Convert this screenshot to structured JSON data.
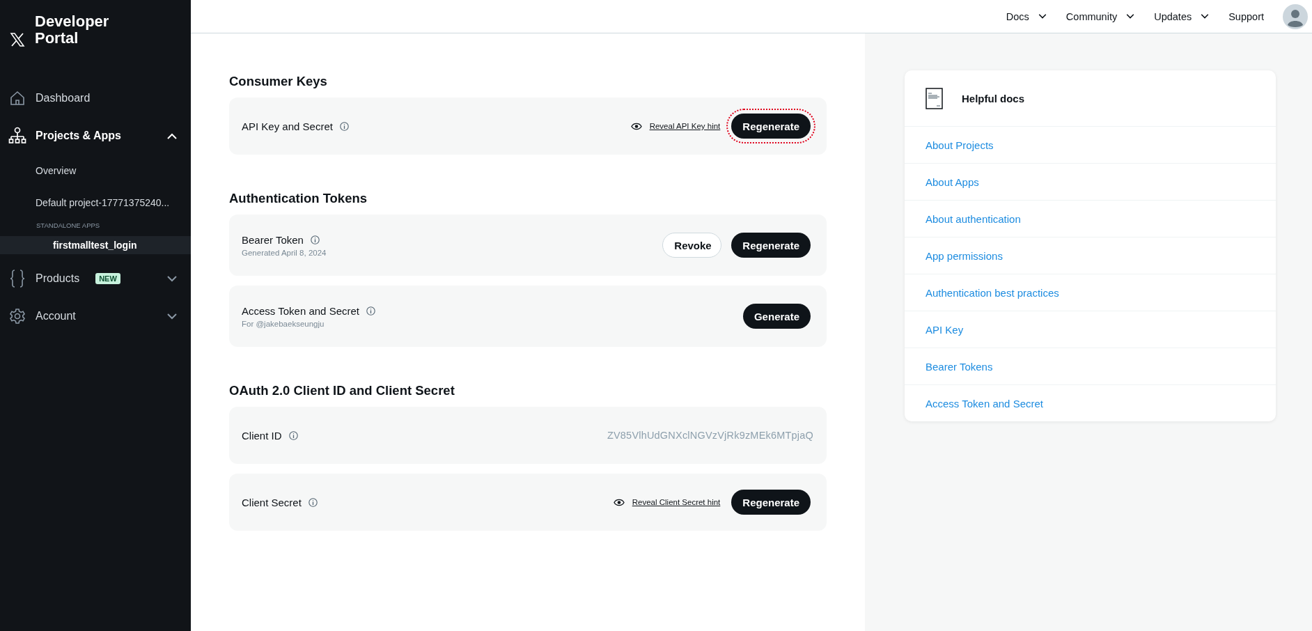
{
  "sidebar": {
    "brand": "Developer Portal",
    "items": [
      {
        "kind": "nav",
        "label": "Dashboard",
        "selected": false
      },
      {
        "kind": "group",
        "label": "Projects & Apps",
        "expanded": true,
        "selected": false,
        "children": [
          {
            "kind": "link",
            "label": "Overview",
            "selected": false
          },
          {
            "kind": "link",
            "label": "Default project-17771375240...",
            "selected": false
          },
          {
            "kind": "section",
            "label": "STANDALONE APPS"
          },
          {
            "kind": "app",
            "label": "firstmalltest_login",
            "selected": true
          }
        ]
      },
      {
        "kind": "group",
        "label": "Products",
        "badge": "NEW",
        "expanded": false,
        "selected": false
      },
      {
        "kind": "group",
        "label": "Account",
        "expanded": false,
        "selected": false
      }
    ]
  },
  "topbar": {
    "menus": [
      {
        "kind": "dropdown",
        "label": "Docs"
      },
      {
        "kind": "dropdown",
        "label": "Community"
      },
      {
        "kind": "dropdown",
        "label": "Updates"
      },
      {
        "kind": "link",
        "label": "Support"
      }
    ]
  },
  "sections": [
    {
      "title": "Consumer Keys",
      "rows": [
        {
          "label": "API Key and Secret",
          "actions": [
            {
              "kind": "reveal",
              "label": "Reveal API Key hint"
            },
            {
              "kind": "primary",
              "label": "Regenerate",
              "focused": true
            }
          ]
        }
      ]
    },
    {
      "title": "Authentication Tokens",
      "rows": [
        {
          "label": "Bearer Token",
          "sub": "Generated April 8, 2024",
          "actions": [
            {
              "kind": "outline",
              "label": "Revoke",
              "focused": false
            },
            {
              "kind": "primary",
              "label": "Regenerate",
              "focused": false
            }
          ]
        },
        {
          "label": "Access Token and Secret",
          "sub": "For @jakebaekseungju",
          "actions": [
            {
              "kind": "primary",
              "label": "Generate",
              "focused": false
            }
          ]
        }
      ]
    },
    {
      "title": "OAuth 2.0 Client ID and Client Secret",
      "rows": [
        {
          "label": "Client ID",
          "actions": [
            {
              "kind": "value",
              "label": "ZV85VlhUdGNXclNGVzVjRk9zMEk6MTpjaQ"
            }
          ]
        },
        {
          "label": "Client Secret",
          "actions": [
            {
              "kind": "reveal",
              "label": "Reveal Client Secret hint"
            },
            {
              "kind": "primary",
              "label": "Regenerate",
              "focused": false
            }
          ]
        }
      ]
    }
  ],
  "helpful_docs": {
    "title": "Helpful docs",
    "links": [
      "About Projects",
      "About Apps",
      "About authentication",
      "App permissions",
      "Authentication best practices",
      "API Key",
      "Bearer Tokens",
      "Access Token and Secret"
    ]
  }
}
